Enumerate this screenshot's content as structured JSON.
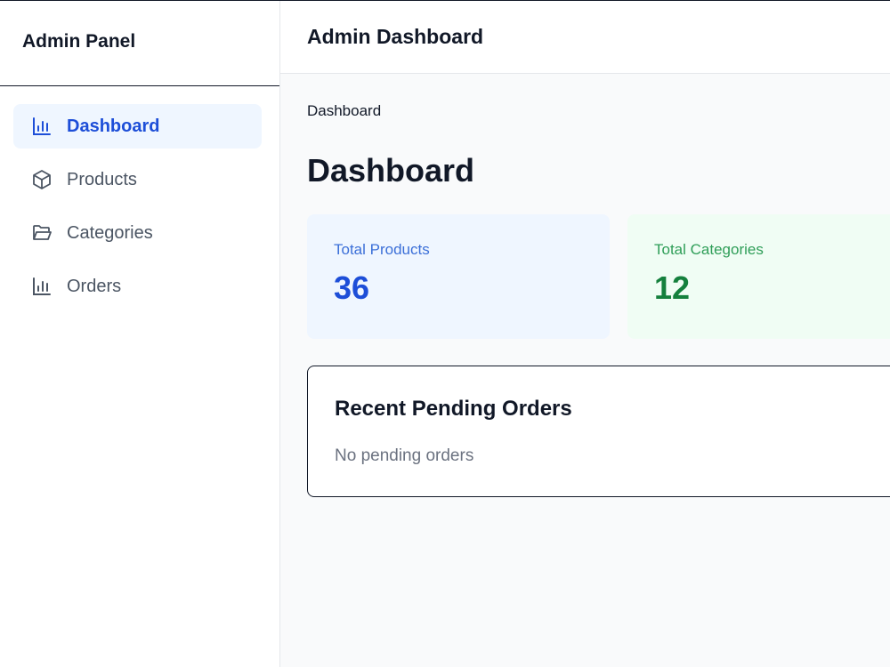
{
  "sidebar": {
    "brand": "Admin Panel",
    "items": [
      {
        "label": "Dashboard",
        "icon": "bar-chart-icon",
        "active": true
      },
      {
        "label": "Products",
        "icon": "box-icon",
        "active": false
      },
      {
        "label": "Categories",
        "icon": "folder-open-icon",
        "active": false
      },
      {
        "label": "Orders",
        "icon": "bar-chart-icon",
        "active": false
      }
    ]
  },
  "header": {
    "title": "Admin Dashboard"
  },
  "main": {
    "breadcrumb": "Dashboard",
    "page_title": "Dashboard",
    "stats": [
      {
        "label": "Total Products",
        "value": "36",
        "color": "#1d4ed8"
      },
      {
        "label": "Total Categories",
        "value": "12",
        "color": "#15803d"
      }
    ],
    "orders": {
      "title": "Recent Pending Orders",
      "empty_text": "No pending orders"
    }
  },
  "colors": {
    "accent": "#1d4ed8",
    "active_bg": "#eff6ff",
    "success": "#15803d",
    "success_bg": "#f0fdf4"
  }
}
